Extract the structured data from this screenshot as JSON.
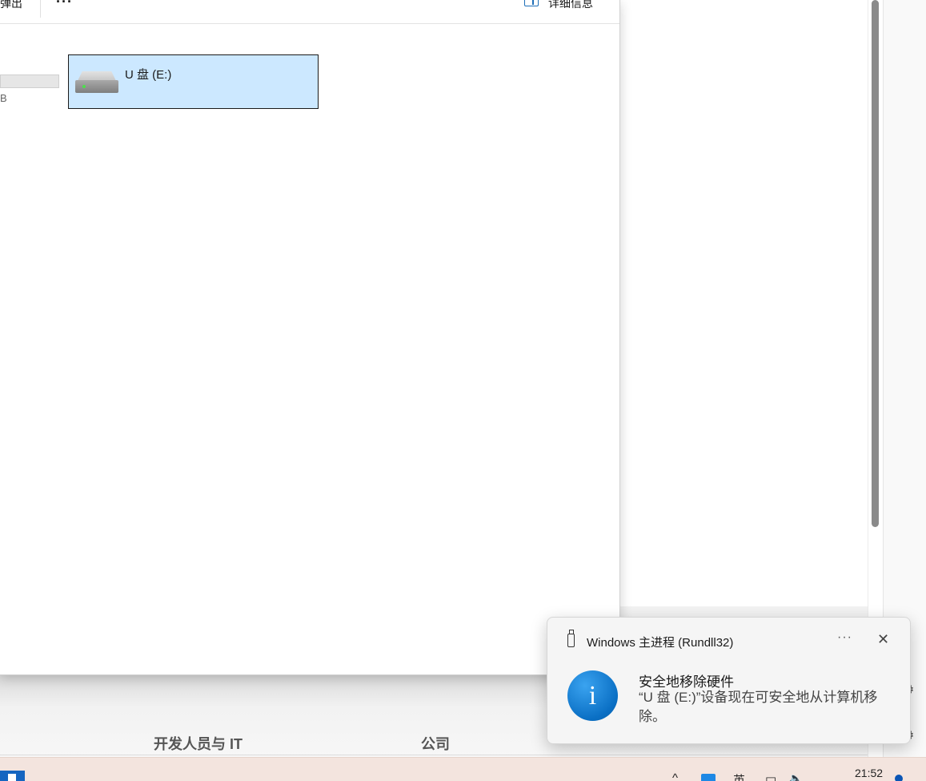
{
  "explorer": {
    "toolbar": {
      "eject_label": "弹出",
      "more_label": "···",
      "details_label": "详细信息"
    },
    "prev_drive_size_suffix": "B",
    "usb_drive": {
      "label": "U 盘 (E:)"
    }
  },
  "browser": {
    "footer": {
      "link_dev": "开发人员与 IT",
      "link_company": "公司"
    },
    "side_icons": [
      "⚙",
      "⚙"
    ]
  },
  "toast": {
    "app_name": "Windows 主进程 (Rundll32)",
    "more_label": "···",
    "close_label": "✕",
    "info_icon_glyph": "i",
    "title": "安全地移除硬件",
    "body": "“U 盘 (E:)”设备现在可安全地从计算机移除。"
  },
  "taskbar": {
    "tray_chevron": "^",
    "language": "英",
    "network_icon": "▭",
    "volume_icon": "🔈",
    "clock": "21:52"
  },
  "colors": {
    "selection": "#cce8ff",
    "info_blue": "#0a6fc4",
    "taskbar": "#f3e4de"
  }
}
